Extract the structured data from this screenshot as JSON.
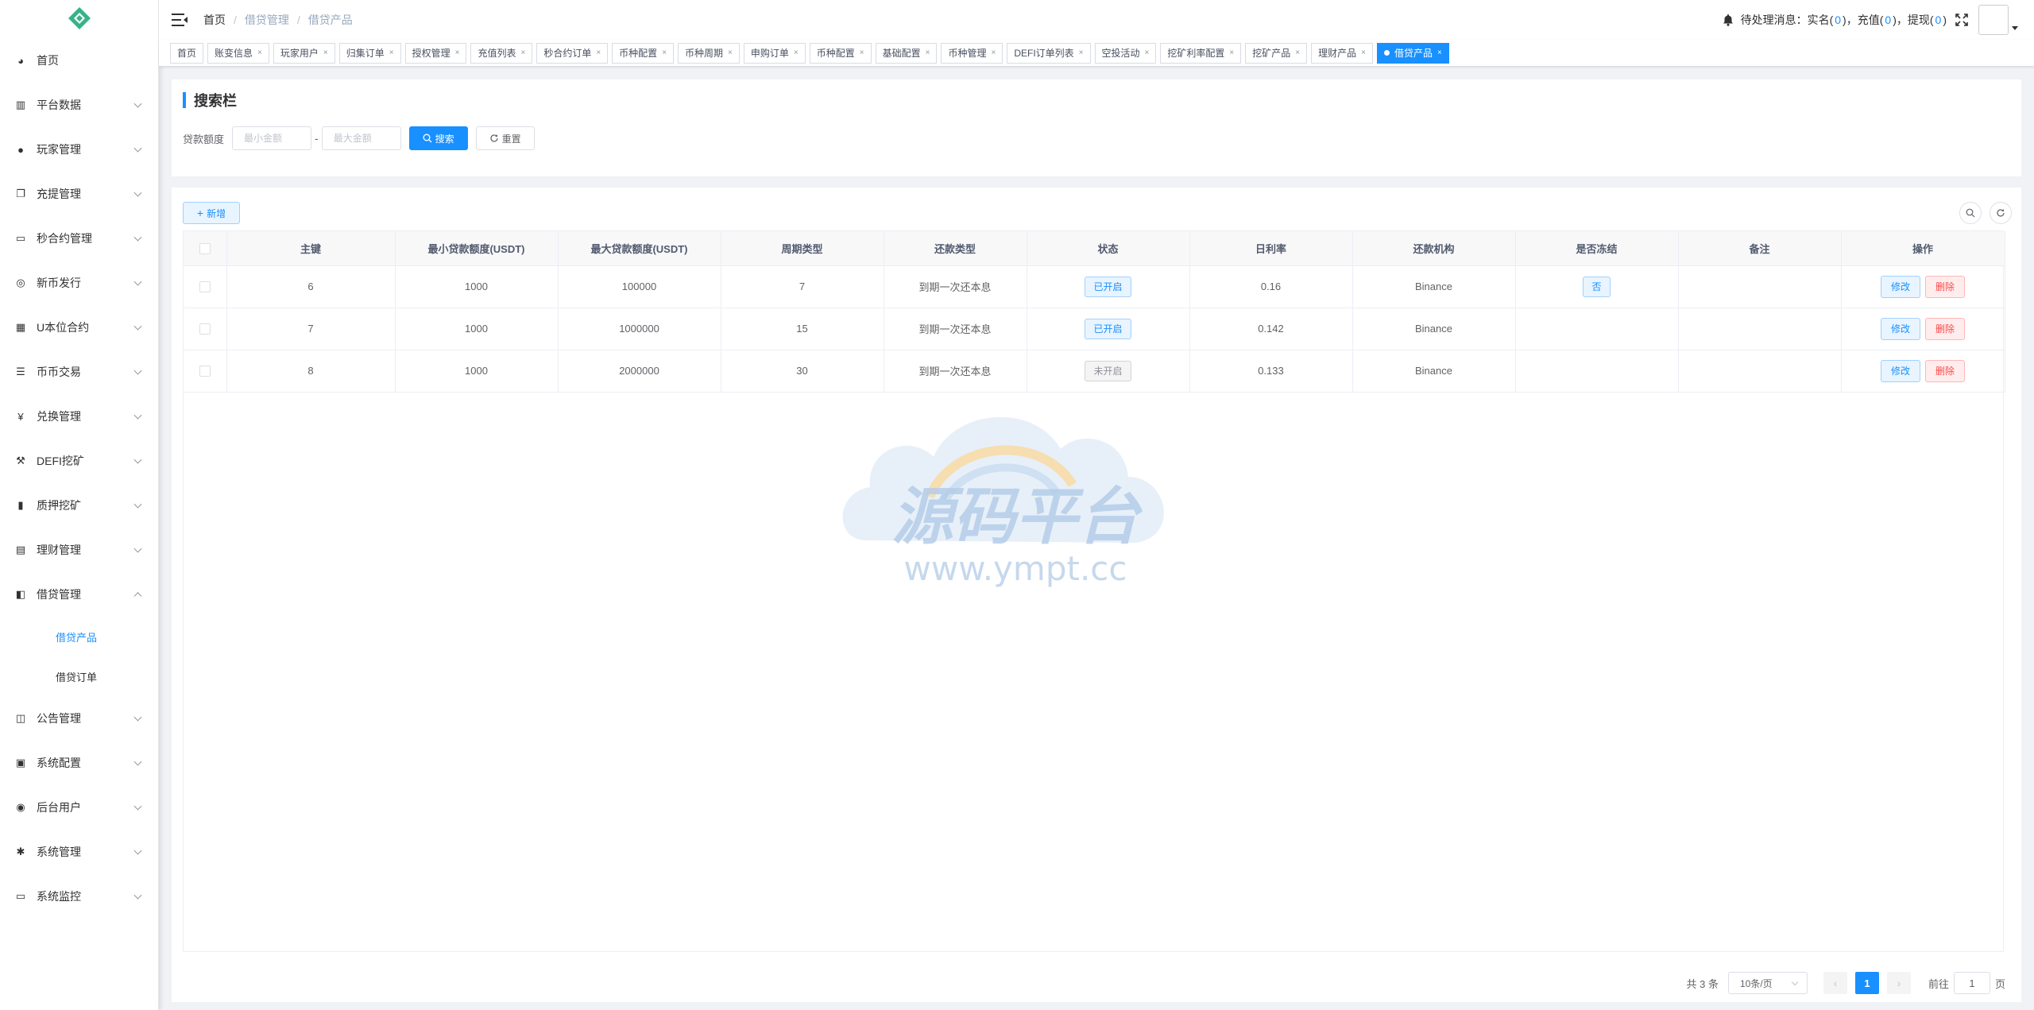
{
  "colors": {
    "primary": "#1890ff",
    "danger": "#ff4949",
    "sidebar_bg": "#ffffff"
  },
  "sidebar": {
    "items": [
      {
        "label": "首页",
        "icon": "dashboard-icon",
        "expandable": false
      },
      {
        "label": "平台数据",
        "icon": "chart-icon",
        "expandable": true
      },
      {
        "label": "玩家管理",
        "icon": "user-icon",
        "expandable": true
      },
      {
        "label": "充提管理",
        "icon": "copy-icon",
        "expandable": true
      },
      {
        "label": "秒合约管理",
        "icon": "monitor-icon",
        "expandable": true
      },
      {
        "label": "新币发行",
        "icon": "coin-icon",
        "expandable": true
      },
      {
        "label": "U本位合约",
        "icon": "grid-icon",
        "expandable": true
      },
      {
        "label": "币币交易",
        "icon": "list-icon",
        "expandable": true
      },
      {
        "label": "兑换管理",
        "icon": "yen-icon",
        "expandable": true
      },
      {
        "label": "DEFI挖矿",
        "icon": "pickaxe-icon",
        "expandable": true
      },
      {
        "label": "质押挖矿",
        "icon": "bar-chart-icon",
        "expandable": true
      },
      {
        "label": "理财管理",
        "icon": "document-icon",
        "expandable": true
      },
      {
        "label": "借贷管理",
        "icon": "book-icon",
        "expandable": true,
        "open": true,
        "children": [
          {
            "label": "借贷产品",
            "active": true
          },
          {
            "label": "借贷订单",
            "active": false
          }
        ]
      },
      {
        "label": "公告管理",
        "icon": "open-book-icon",
        "expandable": true
      },
      {
        "label": "系统配置",
        "icon": "config-icon",
        "expandable": true
      },
      {
        "label": "后台用户",
        "icon": "users-icon",
        "expandable": true
      },
      {
        "label": "系统管理",
        "icon": "gear-icon",
        "expandable": true
      },
      {
        "label": "系统监控",
        "icon": "monitor-icon",
        "expandable": true
      }
    ]
  },
  "header": {
    "breadcrumb": [
      "首页",
      "借贷管理",
      "借贷产品"
    ],
    "notice_prefix": "待处理消息：",
    "notices": [
      {
        "label": "实名",
        "count": "0",
        "suffix": "，"
      },
      {
        "label": "充值",
        "count": "0",
        "suffix": "，"
      },
      {
        "label": "提现",
        "count": "0",
        "suffix": ""
      }
    ]
  },
  "tags": [
    {
      "label": "首页",
      "closable": false
    },
    {
      "label": "账变信息",
      "closable": true
    },
    {
      "label": "玩家用户",
      "closable": true
    },
    {
      "label": "归集订单",
      "closable": true
    },
    {
      "label": "授权管理",
      "closable": true
    },
    {
      "label": "充值列表",
      "closable": true
    },
    {
      "label": "秒合约订单",
      "closable": true
    },
    {
      "label": "币种配置",
      "closable": true
    },
    {
      "label": "币种周期",
      "closable": true
    },
    {
      "label": "申购订单",
      "closable": true
    },
    {
      "label": "币种配置",
      "closable": true
    },
    {
      "label": "基础配置",
      "closable": true
    },
    {
      "label": "币种管理",
      "closable": true
    },
    {
      "label": "DEFI订单列表",
      "closable": true
    },
    {
      "label": "空投活动",
      "closable": true
    },
    {
      "label": "挖矿利率配置",
      "closable": true
    },
    {
      "label": "挖矿产品",
      "closable": true
    },
    {
      "label": "理财产品",
      "closable": true
    },
    {
      "label": "借贷产品",
      "closable": true,
      "active": true
    }
  ],
  "search": {
    "title": "搜索栏",
    "label": "贷款额度",
    "min_placeholder": "最小金额",
    "max_placeholder": "最大金额",
    "dash": "-",
    "search_label": "搜索",
    "reset_label": "重置"
  },
  "toolbar": {
    "add_label": "新增"
  },
  "table": {
    "columns": [
      "主键",
      "最小贷款额度(USDT)",
      "最大贷款额度(USDT)",
      "周期类型",
      "还款类型",
      "状态",
      "日利率",
      "还款机构",
      "是否冻结",
      "备注",
      "操作"
    ],
    "rows": [
      {
        "id": "6",
        "min": "1000",
        "max": "100000",
        "period": "7",
        "repay_type": "到期一次还本息",
        "status": "已开启",
        "status_on": true,
        "rate": "0.16",
        "org": "Binance",
        "frozen": "否",
        "remark": ""
      },
      {
        "id": "7",
        "min": "1000",
        "max": "1000000",
        "period": "15",
        "repay_type": "到期一次还本息",
        "status": "已开启",
        "status_on": true,
        "rate": "0.142",
        "org": "Binance",
        "frozen": "",
        "remark": ""
      },
      {
        "id": "8",
        "min": "1000",
        "max": "2000000",
        "period": "30",
        "repay_type": "到期一次还本息",
        "status": "未开启",
        "status_on": false,
        "rate": "0.133",
        "org": "Binance",
        "frozen": "",
        "remark": ""
      }
    ],
    "edit_label": "修改",
    "delete_label": "删除"
  },
  "watermark": {
    "title": "源码平台",
    "url": "www.ympt.cc"
  },
  "pagination": {
    "total_text": "共 3 条",
    "page_size": "10条/页",
    "current_page": "1",
    "goto_prefix": "前往",
    "goto_value": "1",
    "goto_suffix": "页"
  }
}
